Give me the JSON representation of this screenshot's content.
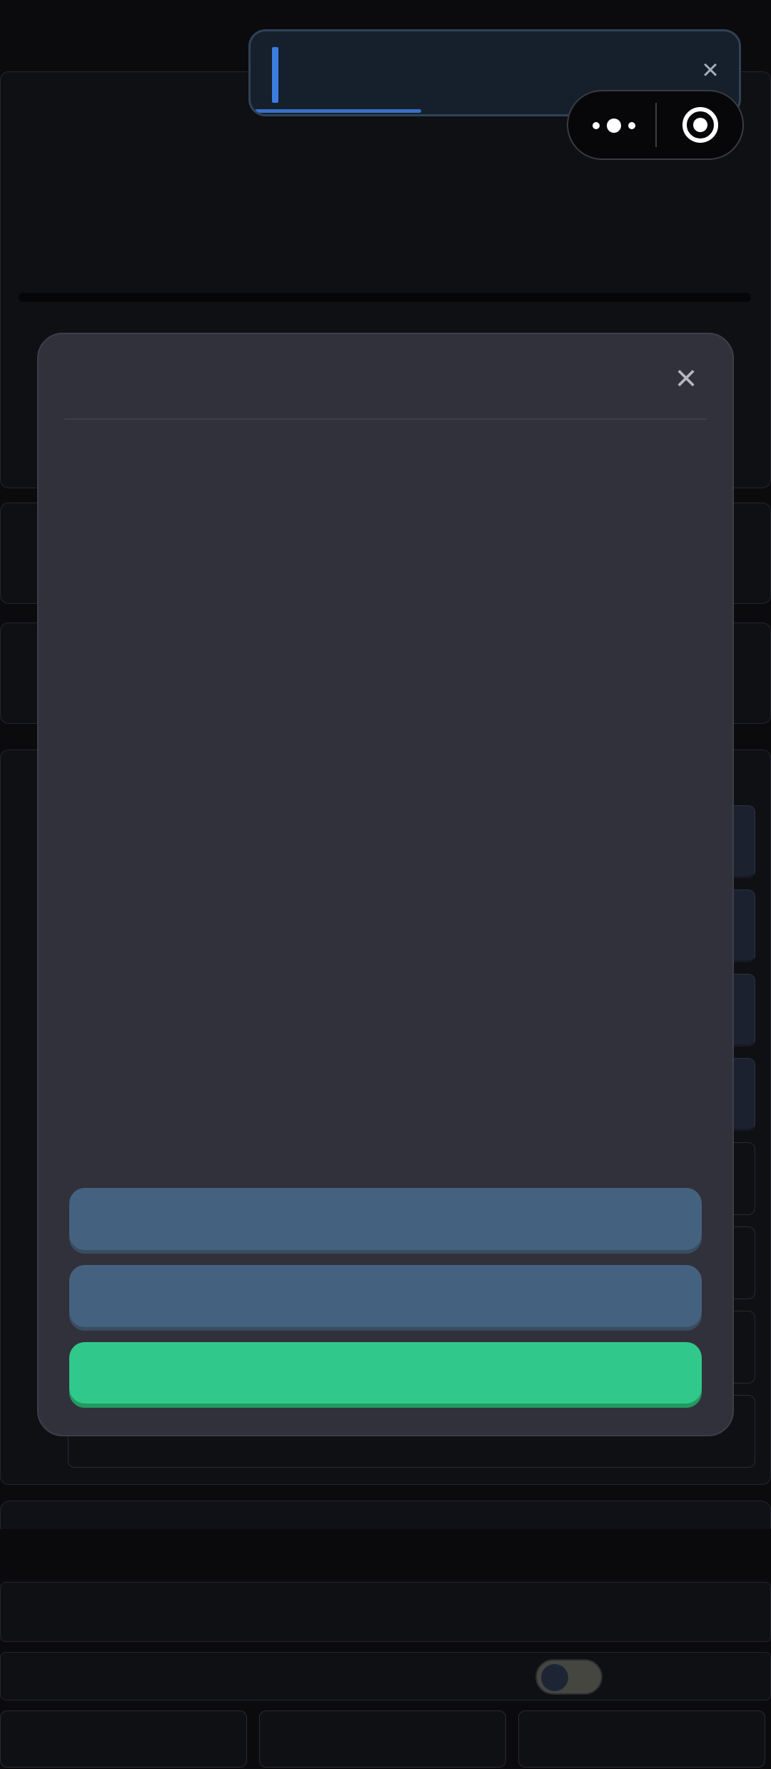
{
  "notification": {
    "close_icon": "close-icon",
    "progress_fraction": 0.34,
    "colors": {
      "cursor": "#3b7de0",
      "progress": "#3b70c6"
    }
  },
  "capsule": {
    "more_icon": "more-dots-icon",
    "target_icon": "record-target-icon"
  },
  "modal": {
    "close_icon": "close-icon",
    "buttons": [
      {
        "label": "",
        "color": "#44627f"
      },
      {
        "label": "",
        "color": "#44627f"
      },
      {
        "label": "",
        "color": "#31c98b"
      }
    ]
  },
  "settings": {
    "toggle": {
      "on": false
    }
  }
}
